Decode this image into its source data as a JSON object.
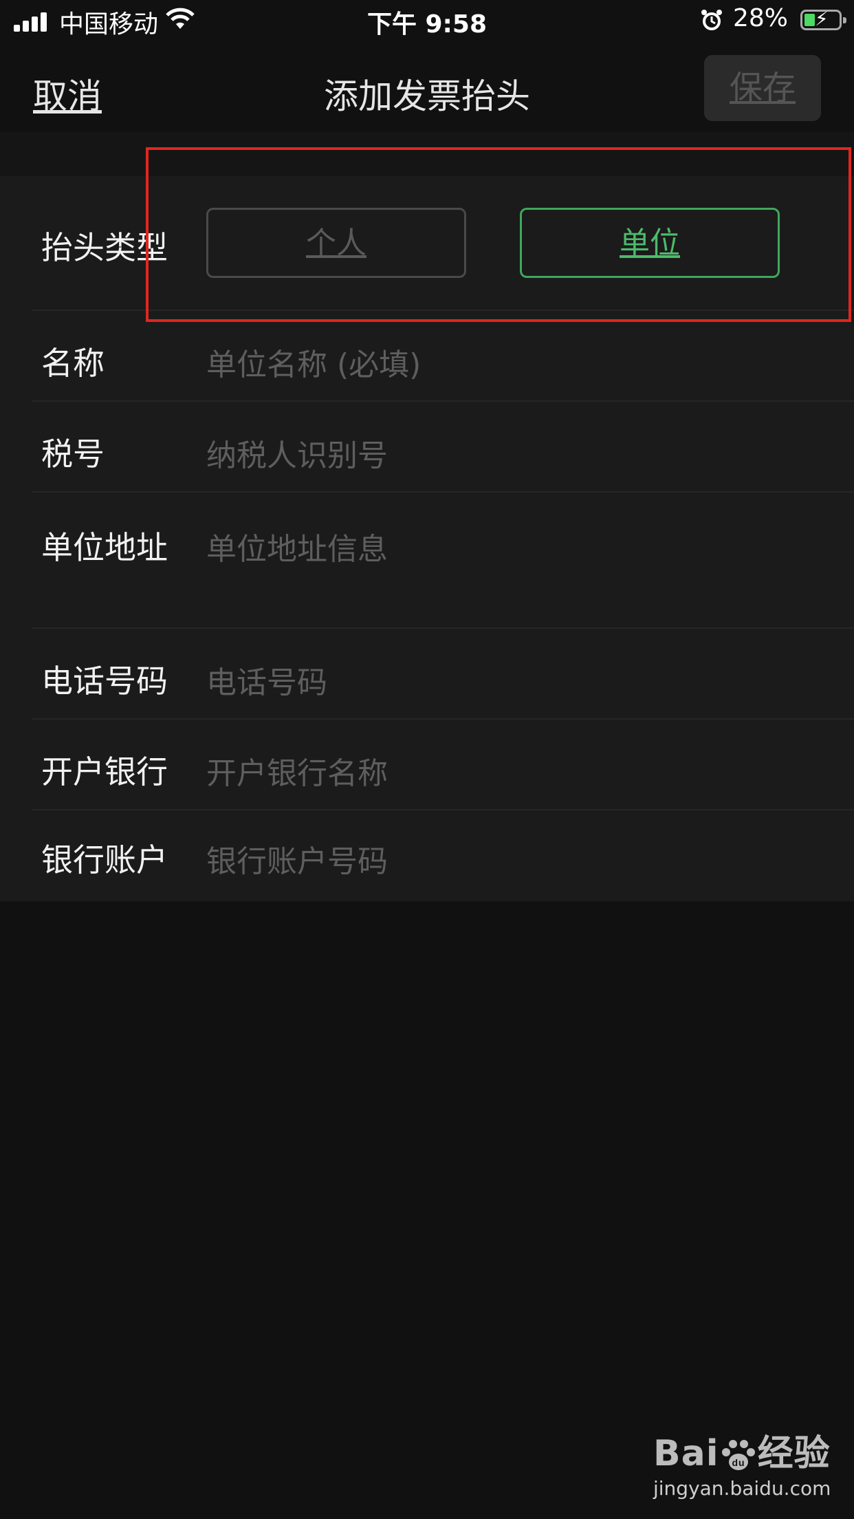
{
  "status_bar": {
    "carrier": "中国移动",
    "time": "下午 9:58",
    "battery": "28%"
  },
  "nav": {
    "cancel": "取消",
    "title": "添加发票抬头",
    "save": "保存"
  },
  "form": {
    "header_type": {
      "label": "抬头类型",
      "options": [
        "个人",
        "单位"
      ],
      "selected": "单位"
    },
    "fields": [
      {
        "label": "名称",
        "placeholder": "单位名称 (必填)"
      },
      {
        "label": "税号",
        "placeholder": "纳税人识别号"
      },
      {
        "label": "单位地址",
        "placeholder": "单位地址信息"
      },
      {
        "label": "电话号码",
        "placeholder": "电话号码"
      },
      {
        "label": "开户银行",
        "placeholder": "开户银行名称"
      },
      {
        "label": "银行账户",
        "placeholder": "银行账户号码"
      }
    ]
  },
  "watermark": {
    "url": "jingyan.baidu.com"
  },
  "colors": {
    "accent": "#4cbb6c",
    "highlight": "#e02620"
  }
}
